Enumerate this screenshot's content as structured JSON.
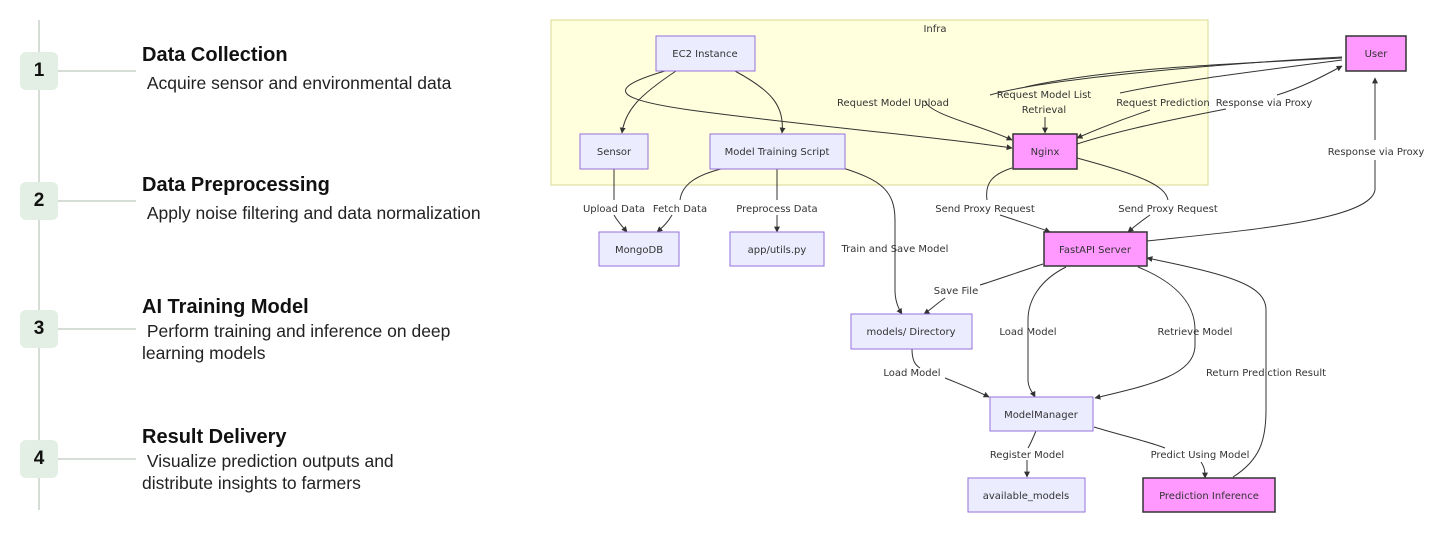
{
  "timeline": {
    "steps": [
      {
        "number": "1",
        "title": "Data Collection",
        "description": " Acquire sensor and environmental data"
      },
      {
        "number": "2",
        "title": "Data Preprocessing",
        "description": " Apply noise filtering and data normalization"
      },
      {
        "number": "3",
        "title": "AI Training Model",
        "description": " Perform training and inference on deep\nlearning models"
      },
      {
        "number": "4",
        "title": "Result Delivery",
        "description": " Visualize prediction outputs and\ndistribute insights to farmers"
      }
    ]
  },
  "diagram": {
    "subgraph_label": "Infra",
    "colors": {
      "subgraph_fill": "#ffffde",
      "subgraph_stroke": "#d8d890",
      "node_fill": "#ececff",
      "node_stroke": "#9370db",
      "highlight_fill": "#ff99ff",
      "highlight_stroke": "#333333",
      "edge": "#333333"
    },
    "nodes": {
      "ec2": "EC2 Instance",
      "sensor": "Sensor",
      "training_script": "Model Training Script",
      "nginx": "Nginx",
      "user": "User",
      "mongodb": "MongoDB",
      "utils": "app/utils.py",
      "fastapi": "FastAPI Server",
      "models_dir": "models/ Directory",
      "model_manager": "ModelManager",
      "available_models": "available_models",
      "prediction_inference": "Prediction Inference"
    },
    "edge_labels": {
      "request_model_upload": "Request Model Upload",
      "request_model_list_1": "Request Model List",
      "request_model_list_2": "Retrieval",
      "request_prediction": "Request Prediction",
      "response_via_proxy_1": "Response via Proxy",
      "response_via_proxy_2": "Response via Proxy",
      "upload_data": "Upload Data",
      "fetch_data": "Fetch Data",
      "preprocess_data": "Preprocess Data",
      "train_and_save": "Train and Save Model",
      "send_proxy_1": "Send Proxy Request",
      "send_proxy_2": "Send Proxy Request",
      "save_file": "Save File",
      "load_model_1": "Load Model",
      "load_model_2": "Load Model",
      "retrieve_model": "Retrieve Model",
      "return_prediction": "Return Prediction Result",
      "register_model": "Register Model",
      "predict_using_model": "Predict Using Model"
    }
  }
}
